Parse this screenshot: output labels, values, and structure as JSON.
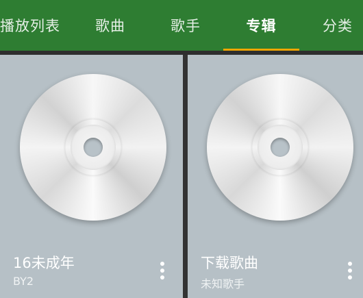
{
  "tabs": [
    {
      "label": "播放列表",
      "active": false
    },
    {
      "label": "歌曲",
      "active": false
    },
    {
      "label": "歌手",
      "active": false
    },
    {
      "label": "专辑",
      "active": true
    },
    {
      "label": "分类",
      "active": false
    }
  ],
  "colors": {
    "toolbar": "#2e7d32",
    "indicator": "#f0a500",
    "card_background": "#b6c0c6"
  },
  "albums": [
    {
      "title": "16未成年",
      "artist": "BY2",
      "icon": "cd-icon"
    },
    {
      "title": "下载歌曲",
      "artist": "未知歌手",
      "icon": "cd-icon"
    }
  ]
}
